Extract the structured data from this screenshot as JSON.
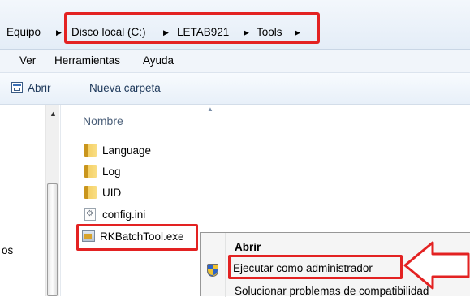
{
  "breadcrumb": {
    "items": [
      "Equipo",
      "Disco local (C:)",
      "LETAB921",
      "Tools"
    ]
  },
  "menubar": {
    "items": [
      "Ver",
      "Herramientas",
      "Ayuda"
    ]
  },
  "toolbar": {
    "open_label": "Abrir",
    "new_folder_label": "Nueva carpeta"
  },
  "navpane": {
    "partial_label": "os"
  },
  "filelist": {
    "column_name": "Nombre",
    "files": [
      {
        "name": "Language",
        "icon": "folder-icon"
      },
      {
        "name": "Log",
        "icon": "folder-icon"
      },
      {
        "name": "UID",
        "icon": "folder-icon"
      },
      {
        "name": "config.ini",
        "icon": "ini-file-icon"
      },
      {
        "name": "RKBatchTool.exe",
        "icon": "exe-file-icon"
      }
    ]
  },
  "context_menu": {
    "items": [
      "Abrir",
      "Ejecutar como administrador",
      "Solucionar problemas de compatibilidad"
    ]
  },
  "annotation_color": "#e32222"
}
